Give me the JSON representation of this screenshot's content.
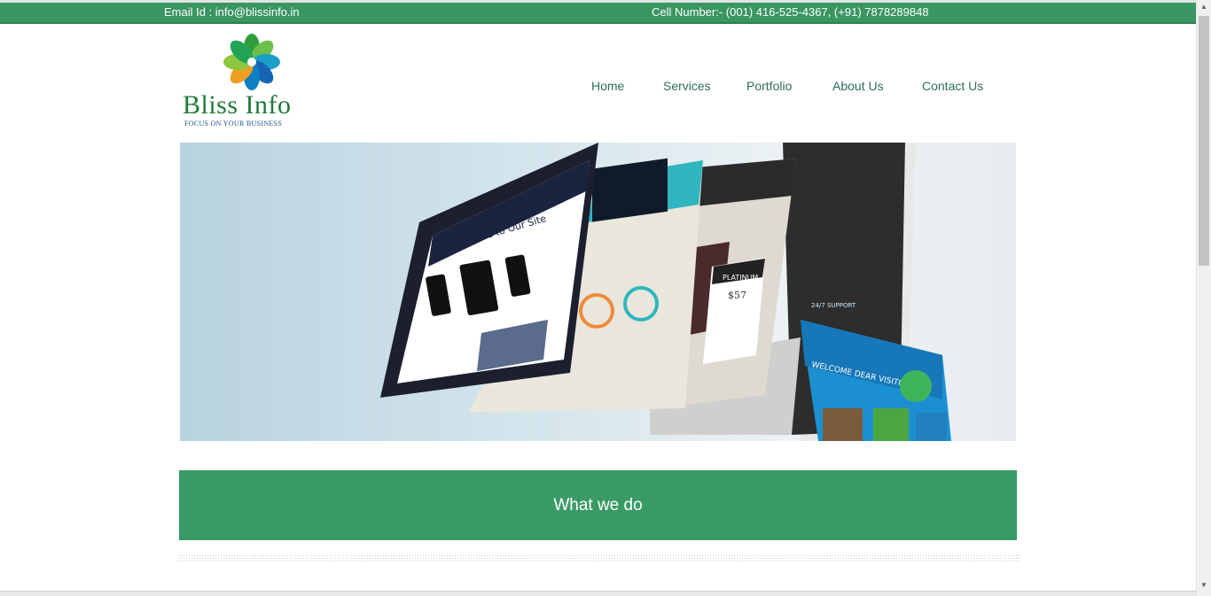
{
  "topbar": {
    "email": "Email Id : info@blissinfo.in",
    "phone": "Cell Number:-  (001) 416-525-4367,  (+91) 7878289848"
  },
  "logo": {
    "brand": "Bliss Info",
    "tagline": "FOCUS ON YOUR BUSINESS"
  },
  "nav": {
    "items": [
      {
        "label": "Home"
      },
      {
        "label": "Services"
      },
      {
        "label": "Portfolio"
      },
      {
        "label": "About Us"
      },
      {
        "label": "Contact Us"
      }
    ]
  },
  "hero": {
    "screen1_heading": "Welcome to Our Site",
    "screen3_badge": "PLATINUM",
    "screen3_price": "$57",
    "screen4_heading": "WELCOME DEAR VISITORS",
    "screen4_support": "24/7 SUPPORT"
  },
  "section": {
    "title": "What we do"
  },
  "colors": {
    "brand_green": "#3a9a65",
    "nav_text": "#2e6e5a"
  }
}
